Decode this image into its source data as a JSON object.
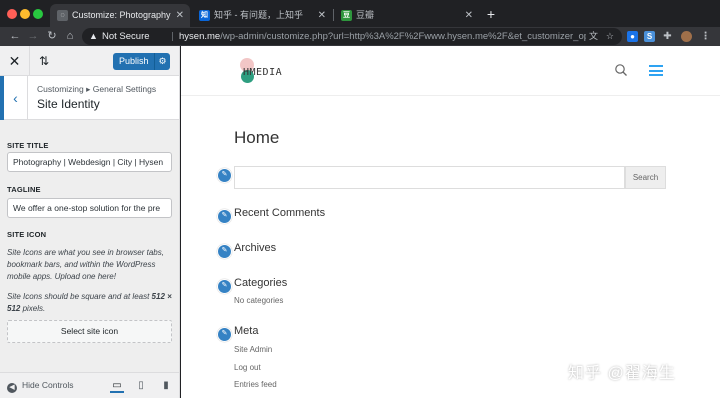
{
  "browser": {
    "tabs": [
      {
        "title": "Customize: Photography | Web",
        "favicon": "",
        "active": true
      },
      {
        "title": "知乎 - 有问题，上知乎",
        "favicon": "知",
        "active": false
      },
      {
        "title": "豆瓣",
        "favicon": "豆",
        "active": false
      }
    ],
    "security_label": "Not Secure",
    "url_domain": "hysen.me",
    "url_path": "/wp-admin/customize.php?url=http%3A%2F%2Fwww.hysen.me%2F&et_customizer_option_s..."
  },
  "customizer": {
    "publish_label": "Publish",
    "breadcrumb": "Customizing ▸ General Settings",
    "section_title": "Site Identity",
    "site_title_label": "SITE TITLE",
    "site_title_value": "Photography | Webdesign | City | Hysen",
    "tagline_label": "TAGLINE",
    "tagline_value": "We offer a one-stop solution for the pre",
    "site_icon_label": "SITE ICON",
    "site_icon_desc1": "Site Icons are what you see in browser tabs, bookmark bars, and within the WordPress mobile apps. Upload one here!",
    "site_icon_desc2_pre": "Site Icons should be square and at least ",
    "site_icon_desc2_bold": "512 × 512",
    "site_icon_desc2_post": " pixels.",
    "select_icon_label": "Select site icon",
    "hide_controls_label": "Hide Controls"
  },
  "preview": {
    "logo_text": "HMEDIA",
    "page_heading": "Home",
    "search_button": "Search",
    "widgets": {
      "recent_comments": "Recent Comments",
      "archives": "Archives",
      "categories": "Categories",
      "categories_empty": "No categories",
      "meta": "Meta",
      "meta_links": [
        "Site Admin",
        "Log out",
        "Entries feed"
      ]
    },
    "watermark": "知乎 @翟海生"
  },
  "colors": {
    "wp_blue": "#2271b1",
    "theme_accent": "#2ea3f2",
    "logo_pink": "#f2c6c6",
    "logo_green": "#2e9e80"
  }
}
